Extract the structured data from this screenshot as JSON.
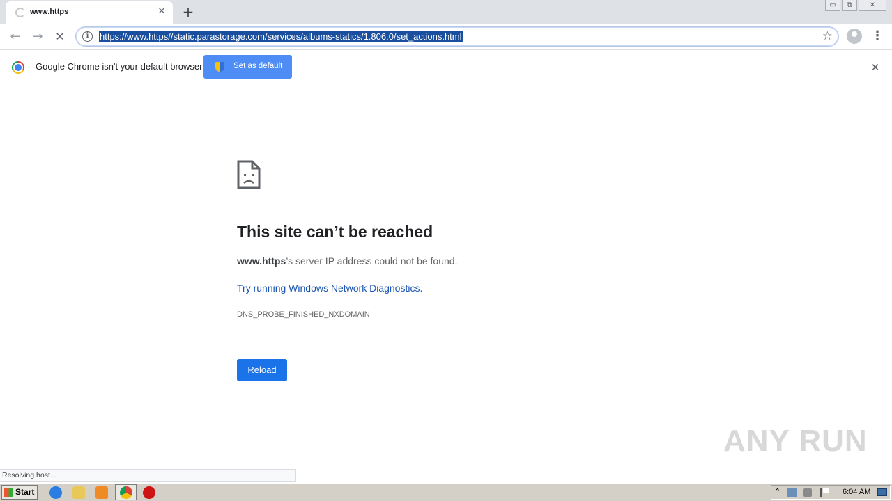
{
  "browser": {
    "tab": {
      "title": "www.https",
      "close": "✕"
    },
    "new_tab": "+",
    "window_controls": {
      "minimize": "▭",
      "restore": "⧉",
      "close": "✕"
    },
    "nav": {
      "back": "←",
      "forward": "→",
      "stop": "✕"
    },
    "address_bar": {
      "url": "https://www.https//static.parastorage.com/services/albums-statics/1.806.0/set_actions.html",
      "info_icon": "i",
      "bookmark_icon": "☆"
    },
    "menu_icon": "⋮"
  },
  "infobar": {
    "message": "Google Chrome isn't your default browser",
    "button": "Set as default",
    "close": "✕"
  },
  "error_page": {
    "title": "This site can’t be reached",
    "host": "www.https",
    "description_suffix": "’s server IP address could not be found.",
    "diagnostics_link": "Try running Windows Network Diagnostics.",
    "error_code": "DNS_PROBE_FINISHED_NXDOMAIN",
    "reload_button": "Reload"
  },
  "status_bubble": "Resolving host...",
  "watermark": "ANY RUN",
  "taskbar": {
    "start": "Start",
    "clock": "6:04 AM",
    "icons": [
      "internet-explorer-icon",
      "folder-icon",
      "media-player-icon",
      "chrome-icon",
      "opera-icon"
    ]
  }
}
